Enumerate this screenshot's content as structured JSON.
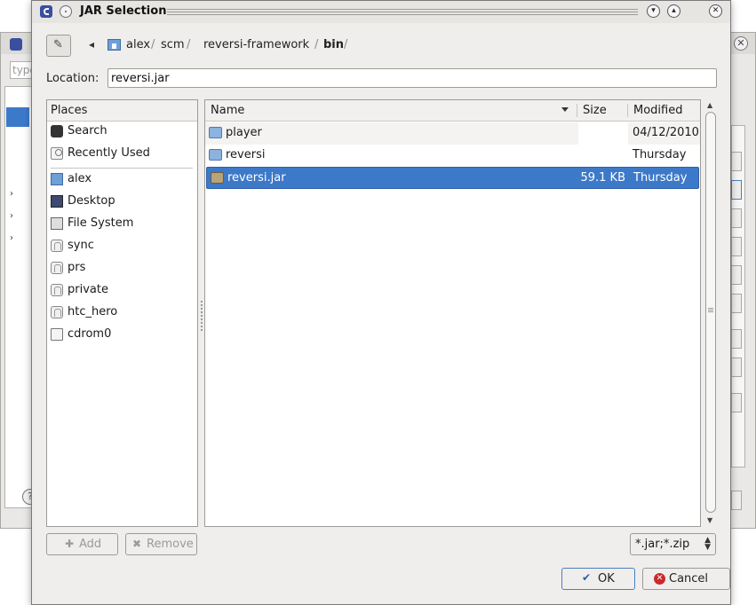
{
  "background_window": {
    "filter_placeholder": "type",
    "help_icon": "help-icon"
  },
  "dialog": {
    "title": "JAR Selection",
    "colors": {
      "selection": "#3d79c9",
      "title_app_icon": "#3a4fa0",
      "cancel_icon": "#cc2a2a"
    }
  },
  "pathbar": {
    "crumbs": [
      "alex",
      "scm",
      "reversi-framework",
      "bin"
    ],
    "separator": "/"
  },
  "location": {
    "label": "Location:",
    "value": "reversi.jar"
  },
  "places": {
    "header": "Places",
    "items": [
      {
        "label": "Search",
        "icon": "binoculars-icon"
      },
      {
        "label": "Recently Used",
        "icon": "recent-icon"
      },
      {
        "label": "alex",
        "icon": "home-folder-icon"
      },
      {
        "label": "Desktop",
        "icon": "desktop-icon"
      },
      {
        "label": "File System",
        "icon": "filesystem-icon"
      },
      {
        "label": "sync",
        "icon": "drive-icon"
      },
      {
        "label": "prs",
        "icon": "drive-icon"
      },
      {
        "label": "private",
        "icon": "drive-icon"
      },
      {
        "label": "htc_hero",
        "icon": "drive-icon"
      },
      {
        "label": "cdrom0",
        "icon": "cdrom-icon"
      }
    ]
  },
  "files": {
    "columns": {
      "name": "Name",
      "size": "Size",
      "modified": "Modified"
    },
    "rows": [
      {
        "name": "player",
        "size": "",
        "modified": "04/12/2010",
        "icon": "folder-icon",
        "selected": false
      },
      {
        "name": "reversi",
        "size": "",
        "modified": "Thursday",
        "icon": "folder-icon",
        "selected": false
      },
      {
        "name": "reversi.jar",
        "size": "59.1 KB",
        "modified": "Thursday",
        "icon": "jar-file-icon",
        "selected": true
      }
    ]
  },
  "buttons": {
    "add": "Add",
    "remove": "Remove",
    "filter": "*.jar;*.zip",
    "ok": "OK",
    "cancel": "Cancel"
  }
}
